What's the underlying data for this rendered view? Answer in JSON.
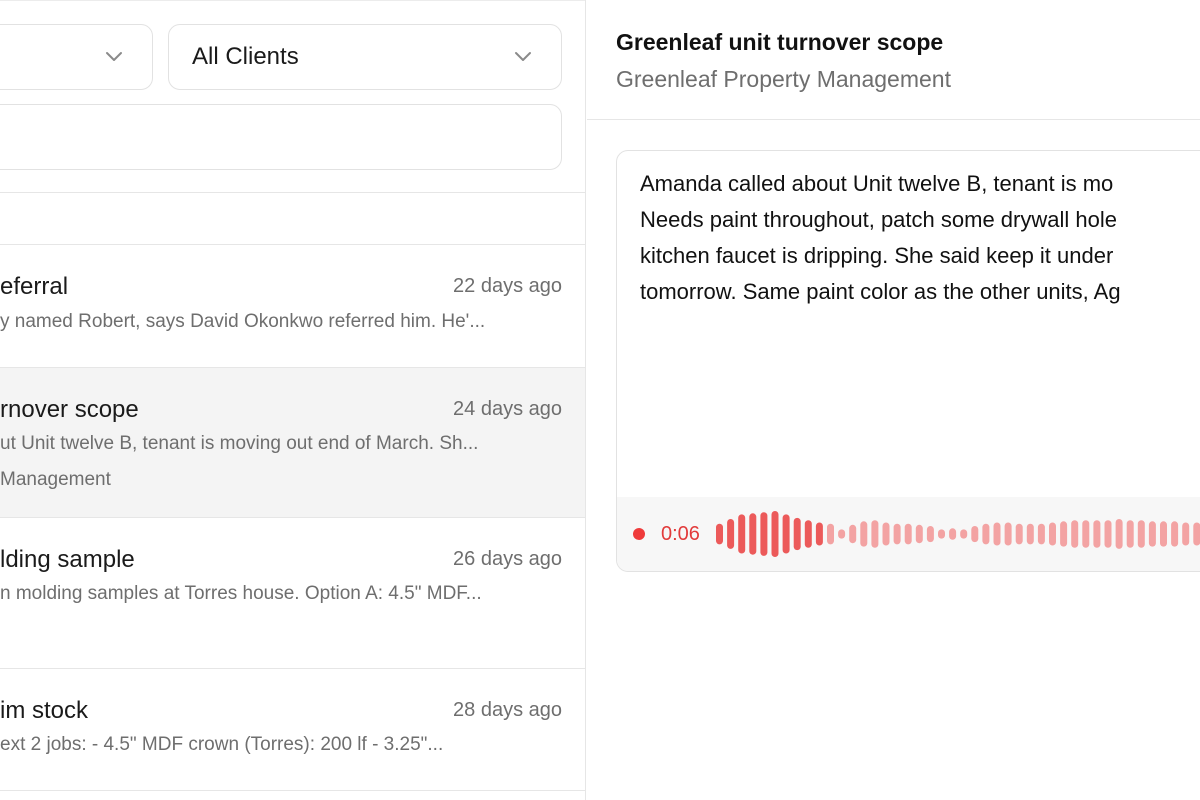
{
  "filters": {
    "first_select_value": "",
    "client_select_value": "All Clients"
  },
  "search": {
    "placeholder": "",
    "value": ""
  },
  "notes": [
    {
      "title": "eferral",
      "date": "22 days ago",
      "preview": "y named Robert, says David Okonkwo referred him. He'...",
      "client": "",
      "selected": false
    },
    {
      "title": "rnover scope",
      "date": "24 days ago",
      "preview": "ut Unit twelve B, tenant is moving out end of March. Sh...",
      "client": "Management",
      "selected": true
    },
    {
      "title": "lding sample",
      "date": "26 days ago",
      "preview": "n molding samples at Torres house. Option A: 4.5\" MDF...",
      "client": "",
      "selected": false
    },
    {
      "title": "im stock",
      "date": "28 days ago",
      "preview": "ext 2 jobs: - 4.5\" MDF crown (Torres): 200 lf - 3.25\"...",
      "client": "",
      "selected": false
    }
  ],
  "detail": {
    "title": "Greenleaf unit turnover scope",
    "client": "Greenleaf Property Management",
    "body_lines": [
      "Amanda called about Unit twelve B, tenant is mo",
      "Needs paint throughout, patch some drywall hole",
      "kitchen faucet is dripping. She said keep it under",
      "tomorrow. Same paint color as the other units, Ag"
    ],
    "audio": {
      "elapsed": "0:06",
      "levels": [
        0.45,
        0.65,
        0.85,
        0.9,
        0.95,
        1.0,
        0.85,
        0.7,
        0.6,
        0.5,
        0.45,
        0.2,
        0.4,
        0.55,
        0.6,
        0.5,
        0.45,
        0.45,
        0.4,
        0.35,
        0.2,
        0.25,
        0.2,
        0.35,
        0.45,
        0.5,
        0.5,
        0.45,
        0.45,
        0.45,
        0.5,
        0.55,
        0.6,
        0.6,
        0.6,
        0.6,
        0.65,
        0.6,
        0.6,
        0.55,
        0.55,
        0.55,
        0.5,
        0.5,
        0.45,
        0.5
      ]
    },
    "colors": {
      "record": "#ef3b3b",
      "wave_strong": "#ec5a5a",
      "wave_light": "#f3a3a3"
    }
  }
}
